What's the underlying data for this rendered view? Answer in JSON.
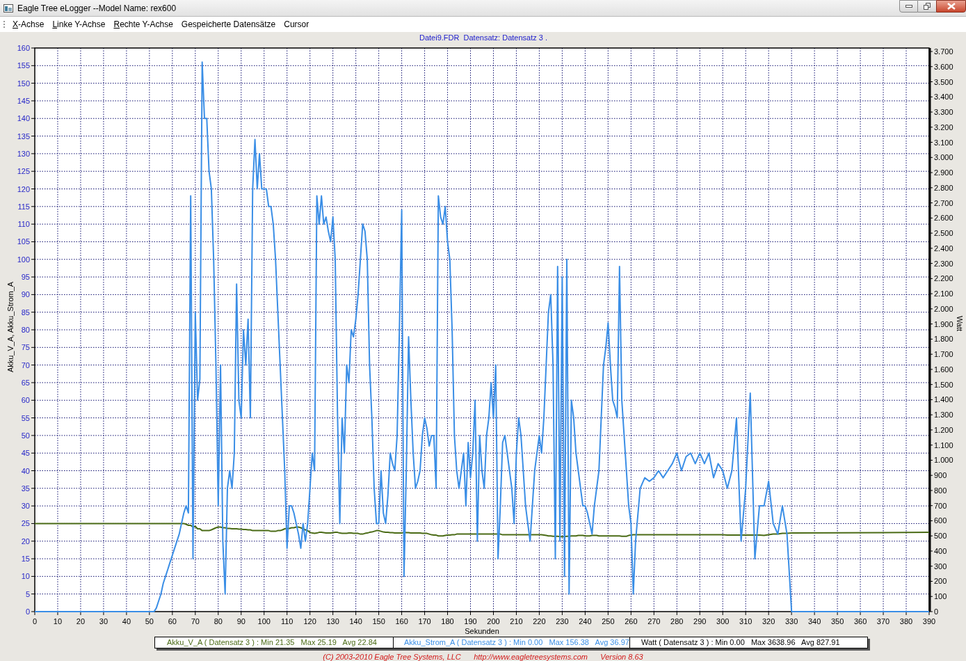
{
  "window": {
    "title": "Eagle Tree eLogger --Model Name: rex600"
  },
  "menu": [
    {
      "label": "X-Achse",
      "mnemonic": true
    },
    {
      "label": "Linke Y-Achse",
      "mnemonic": true
    },
    {
      "label": "Rechte Y-Achse",
      "mnemonic": true
    },
    {
      "label": "Gespeicherte Datensätze",
      "mnemonic": false
    },
    {
      "label": "Cursor",
      "mnemonic": false
    }
  ],
  "chart_header": "Datei9.FDR  Datensatz: Datensatz 3 .",
  "chart_data": {
    "type": "line",
    "grid": true,
    "xlabel": "Sekunden",
    "ylabel": "Akku_V_A, Akku_Strom_A",
    "xlim": [
      0,
      390
    ],
    "ylim": [
      0,
      160
    ],
    "xticks": [
      0,
      10,
      20,
      30,
      40,
      50,
      60,
      70,
      80,
      90,
      100,
      110,
      120,
      130,
      140,
      150,
      160,
      170,
      180,
      190,
      200,
      210,
      220,
      230,
      240,
      250,
      260,
      270,
      280,
      290,
      300,
      310,
      320,
      330,
      340,
      350,
      360,
      370,
      380,
      390
    ],
    "yticks": [
      0,
      5,
      10,
      15,
      20,
      25,
      30,
      35,
      40,
      45,
      50,
      55,
      60,
      65,
      70,
      75,
      80,
      85,
      90,
      95,
      100,
      105,
      110,
      115,
      120,
      125,
      130,
      135,
      140,
      145,
      150,
      155,
      160
    ],
    "x": [
      0,
      52,
      53,
      54,
      55,
      56,
      57,
      58,
      59,
      60,
      61,
      62,
      63,
      64,
      65,
      66,
      67,
      68,
      69,
      70,
      71,
      72,
      73,
      74,
      75,
      76,
      77,
      78,
      79,
      80,
      81,
      82,
      83,
      84,
      85,
      86,
      87,
      88,
      89,
      90,
      91,
      92,
      93,
      94,
      95,
      96,
      97,
      98,
      99,
      100,
      101,
      102,
      103,
      104,
      105,
      106,
      107,
      108,
      109,
      110,
      111,
      112,
      113,
      114,
      115,
      116,
      117,
      118,
      119,
      120,
      121,
      122,
      123,
      124,
      125,
      126,
      127,
      128,
      129,
      130,
      131,
      132,
      133,
      134,
      135,
      136,
      137,
      138,
      139,
      140,
      141,
      142,
      143,
      144,
      145,
      146,
      147,
      148,
      149,
      150,
      151,
      152,
      153,
      154,
      155,
      156,
      157,
      158,
      159,
      160,
      161,
      162,
      163,
      164,
      165,
      166,
      167,
      168,
      169,
      170,
      171,
      172,
      173,
      174,
      175,
      176,
      177,
      178,
      179,
      180,
      181,
      182,
      183,
      184,
      185,
      186,
      187,
      188,
      189,
      190,
      191,
      192,
      193,
      194,
      195,
      196,
      197,
      198,
      199,
      200,
      201,
      202,
      203,
      204,
      205,
      206,
      207,
      208,
      209,
      210,
      211,
      212,
      213,
      214,
      215,
      216,
      217,
      218,
      219,
      220,
      221,
      222,
      223,
      224,
      225,
      226,
      227,
      228,
      229,
      230,
      231,
      232,
      233,
      234,
      235,
      236,
      237,
      238,
      239,
      240,
      241,
      242,
      243,
      244,
      245,
      246,
      247,
      248,
      249,
      250,
      251,
      252,
      253,
      254,
      255,
      256,
      257,
      258,
      259,
      260,
      261,
      262,
      264,
      266,
      268,
      270,
      272,
      274,
      276,
      278,
      280,
      282,
      284,
      286,
      288,
      290,
      292,
      294,
      296,
      298,
      300,
      302,
      304,
      306,
      308,
      310,
      312,
      314,
      316,
      318,
      320,
      322,
      324,
      326,
      328,
      330,
      390
    ],
    "series": [
      {
        "name": "Akku_V_A",
        "color": "#4a6b16",
        "values": [
          25,
          25,
          25,
          25,
          25,
          25,
          25,
          25,
          25,
          25,
          25,
          25,
          25,
          25,
          25,
          24.8,
          24.5,
          24.5,
          24,
          24.2,
          23.5,
          23.5,
          23,
          23,
          23,
          23,
          23.2,
          23.5,
          23.8,
          24,
          24,
          23.8,
          23.8,
          23.6,
          23.6,
          23.5,
          23.5,
          23.5,
          23.4,
          23.4,
          23.3,
          23.3,
          23.2,
          23.2,
          23,
          23,
          23,
          23,
          23,
          23,
          23,
          23,
          22.8,
          22.8,
          22.8,
          23,
          23,
          23.2,
          23.5,
          23.6,
          23.6,
          23.8,
          23.8,
          24,
          24,
          23.8,
          23.5,
          23.2,
          23,
          22.5,
          22.3,
          22.2,
          22.3,
          22.5,
          22.5,
          22.4,
          22.3,
          22.3,
          22.3,
          22.4,
          22.5,
          22.5,
          22.3,
          22.2,
          22.2,
          22.2,
          22.3,
          22.3,
          22.2,
          22.2,
          22.2,
          22,
          22,
          22.2,
          22.3,
          22.5,
          22.6,
          22.8,
          23,
          23,
          22.8,
          22.6,
          22.5,
          22.5,
          22.4,
          22.4,
          22.3,
          22.3,
          22.3,
          22.3,
          22.5,
          22.4,
          22.4,
          22.3,
          22.3,
          22.3,
          22.3,
          22.3,
          22.2,
          22.2,
          22.2,
          22,
          21.8,
          21.7,
          21.7,
          21.5,
          21.5,
          21.5,
          21.6,
          21.7,
          21.7,
          21.8,
          21.8,
          22,
          22,
          22,
          22,
          22,
          22,
          22,
          22,
          22,
          22,
          22,
          22,
          22,
          22,
          22,
          22,
          22,
          22,
          22,
          22,
          21.8,
          21.8,
          21.8,
          21.8,
          21.8,
          21.8,
          21.8,
          21.8,
          21.8,
          21.8,
          21.8,
          21.8,
          21.8,
          21.8,
          21.8,
          21.8,
          21.8,
          21.8,
          21.7,
          21.6,
          21.5,
          21.5,
          21.4,
          21.4,
          21.4,
          21.3,
          21.3,
          21.3,
          21.4,
          21.4,
          21.5,
          21.5,
          21.5,
          21.6,
          21.6,
          21.6,
          21.5,
          21.5,
          21.5,
          21.6,
          21.6,
          21.6,
          21.5,
          21.5,
          21.5,
          21.5,
          21.5,
          21.5,
          21.5,
          21.5,
          21.5,
          21.5,
          21.4,
          21.4,
          21.4,
          21.6,
          21.7,
          21.8,
          21.8,
          21.8,
          21.8,
          21.8,
          21.8,
          21.8,
          21.8,
          21.8,
          21.8,
          21.8,
          21.8,
          21.8,
          21.8,
          21.8,
          21.8,
          21.8,
          21.8,
          21.8,
          21.8,
          21.8,
          21.7,
          21.7,
          21.7,
          21.7,
          21.7,
          21.7,
          21.7,
          21.7,
          21.6,
          21.8,
          22,
          22,
          22.2,
          22.2,
          22.3,
          22.5
        ]
      },
      {
        "name": "Akku_Strom_A",
        "color": "#3a8ee6",
        "values": [
          0,
          0,
          1,
          3,
          5,
          8,
          10,
          12,
          14,
          16,
          18,
          20,
          22,
          25,
          28,
          30,
          28,
          118,
          15,
          85,
          60,
          66,
          156,
          140,
          140,
          125,
          120,
          100,
          70,
          30,
          70,
          20,
          5,
          35,
          40,
          35,
          45,
          93,
          60,
          55,
          80,
          70,
          83,
          55,
          120,
          134,
          120,
          130,
          120,
          120,
          120,
          115,
          115,
          110,
          100,
          85,
          70,
          55,
          40,
          18,
          30,
          30,
          28,
          25,
          22,
          18,
          25,
          20,
          25,
          35,
          45,
          40,
          118,
          110,
          118,
          110,
          112,
          108,
          105,
          112,
          100,
          56,
          25,
          55,
          45,
          70,
          65,
          80,
          78,
          83,
          90,
          100,
          110,
          108,
          100,
          70,
          55,
          35,
          25,
          25,
          40,
          28,
          25,
          33,
          45,
          42,
          40,
          50,
          80,
          114,
          10,
          40,
          78,
          60,
          45,
          35,
          37,
          40,
          50,
          55,
          52,
          47,
          50,
          50,
          35,
          118,
          112,
          110,
          115,
          105,
          100,
          80,
          50,
          40,
          35,
          40,
          45,
          30,
          48,
          38,
          45,
          60,
          20,
          50,
          40,
          35,
          50,
          55,
          65,
          55,
          70,
          15,
          30,
          48,
          50,
          45,
          40,
          35,
          25,
          45,
          55,
          50,
          40,
          30,
          25,
          20,
          30,
          40,
          45,
          50,
          45,
          55,
          70,
          85,
          90,
          70,
          15,
          98,
          20,
          95,
          10,
          100,
          5,
          60,
          55,
          45,
          40,
          35,
          30,
          30,
          28,
          25,
          22,
          30,
          35,
          40,
          55,
          70,
          75,
          82,
          70,
          60,
          58,
          55,
          98,
          60,
          50,
          40,
          30,
          25,
          5,
          20,
          35,
          38,
          37,
          38,
          40,
          38,
          40,
          42,
          45,
          40,
          44,
          45,
          42,
          45,
          42,
          45,
          38,
          42,
          40,
          35,
          40,
          55,
          20,
          35,
          62,
          15,
          30,
          30,
          37,
          25,
          22,
          30,
          22,
          0,
          0
        ]
      }
    ]
  },
  "right_axis": {
    "label": "Watt",
    "ticks": [
      "3.700",
      "3.600",
      "3.500",
      "3.400",
      "3.300",
      "3.200",
      "3.100",
      "3.000",
      "2.900",
      "2.800",
      "2.700",
      "2.600",
      "2.500",
      "2.400",
      "2.300",
      "2.200",
      "2.100",
      "2.000",
      "1.900",
      "1.800",
      "1.700",
      "1.600",
      "1.500",
      "1.400",
      "1.300",
      "1.200",
      "1.100",
      "1.000",
      "900",
      "800",
      "700",
      "600",
      "500",
      "400",
      "300",
      "200",
      "100",
      "0"
    ]
  },
  "legend": [
    {
      "text": " ( Datensatz 3 ) : Min 21.35   Max 25.19   Avg 22.84",
      "color": "#4a6b16"
    },
    {
      "text": " ( Datensatz 3 ) : Min 0.00   Max 156.38   Avg 36.97",
      "color": "#3a8ee6"
    },
    {
      "name": "Watt",
      "text": " ( Datensatz 3 ) : Min 0.00   Max 3638.96   Avg 827.91",
      "color": "#000000"
    }
  ],
  "footer": "(C) 2003-2010 Eagle Tree Systems, LLC      http://www.eagletreesystems.com      Version 8.63"
}
